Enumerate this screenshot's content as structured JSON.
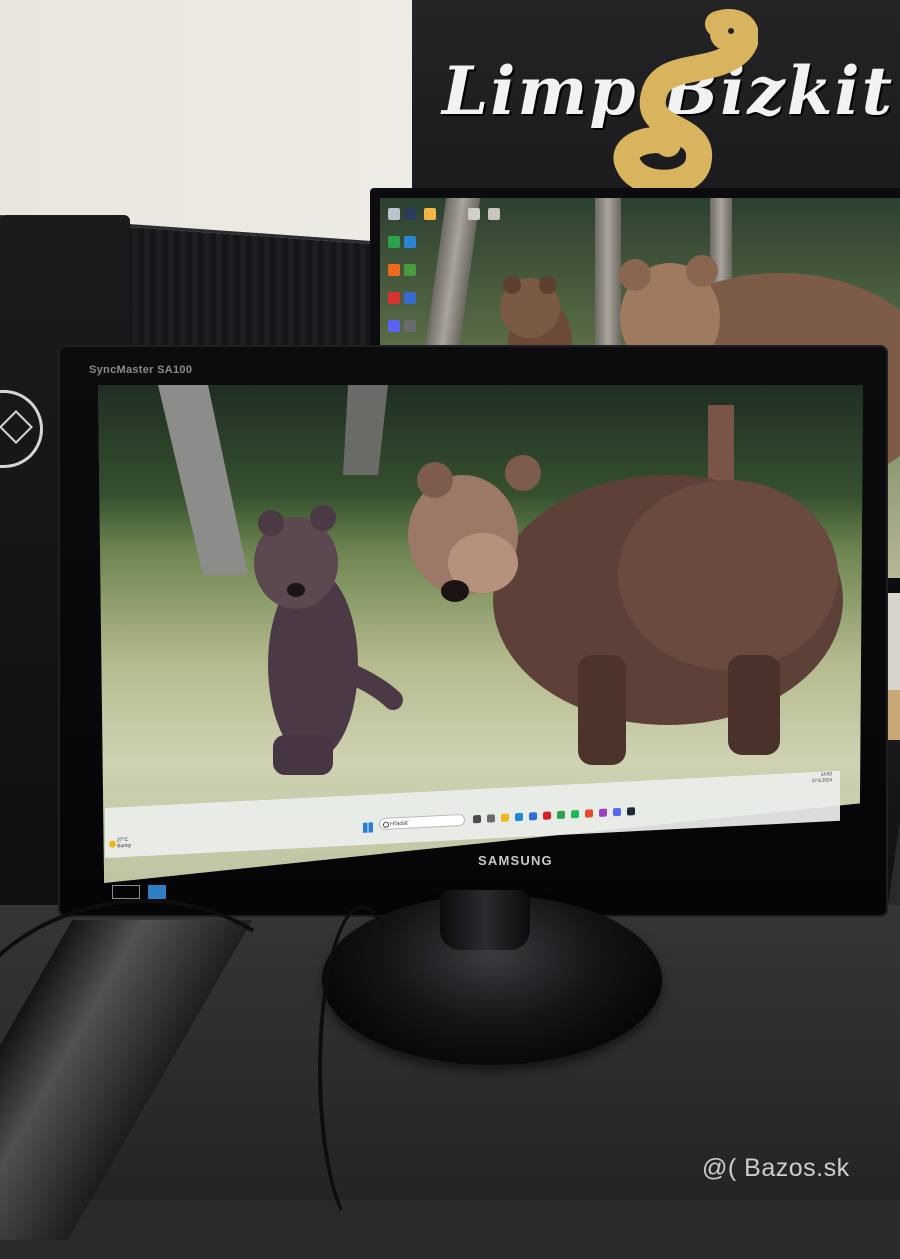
{
  "poster": {
    "text": "Limp Bizkit"
  },
  "rear_monitor": {
    "desktop_icons": [
      {
        "name": "recycle-bin-icon",
        "color": "#b9c4cf"
      },
      {
        "name": "steam-icon",
        "color": "#2a3d5a"
      },
      {
        "name": "folder-icon",
        "color": "#f1b846"
      },
      {
        "name": "chrome-icon",
        "color": "#2ba24c"
      },
      {
        "name": "edge-icon",
        "color": "#2a84d2"
      },
      {
        "name": "firefox-icon",
        "color": "#f06a1d"
      },
      {
        "name": "app-icon",
        "color": "#d8332e"
      },
      {
        "name": "discord-icon",
        "color": "#5865f2"
      },
      {
        "name": "whatsapp-icon",
        "color": "#25d366"
      }
    ]
  },
  "monitor": {
    "model": "SyncMaster SA100",
    "brand": "SAMSUNG"
  },
  "taskbar": {
    "weather_temp": "27°C",
    "weather_desc": "Sunny",
    "search_placeholder": "Hľadať",
    "time": "14:52",
    "date": "27.6.2024",
    "icons": [
      {
        "name": "task-view-icon",
        "color": "#4a4a4a"
      },
      {
        "name": "settings-icon",
        "color": "#6a6a6a"
      },
      {
        "name": "file-explorer-icon",
        "color": "#f2b31c"
      },
      {
        "name": "edge-icon",
        "color": "#1d8ad8"
      },
      {
        "name": "store-icon",
        "color": "#2f6fd6"
      },
      {
        "name": "opera-icon",
        "color": "#d41f2a"
      },
      {
        "name": "chrome-icon",
        "color": "#31a24c"
      },
      {
        "name": "spotify-icon",
        "color": "#1db954"
      },
      {
        "name": "app-icon",
        "color": "#e34b2a"
      },
      {
        "name": "app-icon-2",
        "color": "#9b3fc4"
      },
      {
        "name": "discord-icon",
        "color": "#5865f2"
      },
      {
        "name": "steam-icon",
        "color": "#1b2838"
      }
    ]
  },
  "watermark": "@( Bazos.sk"
}
